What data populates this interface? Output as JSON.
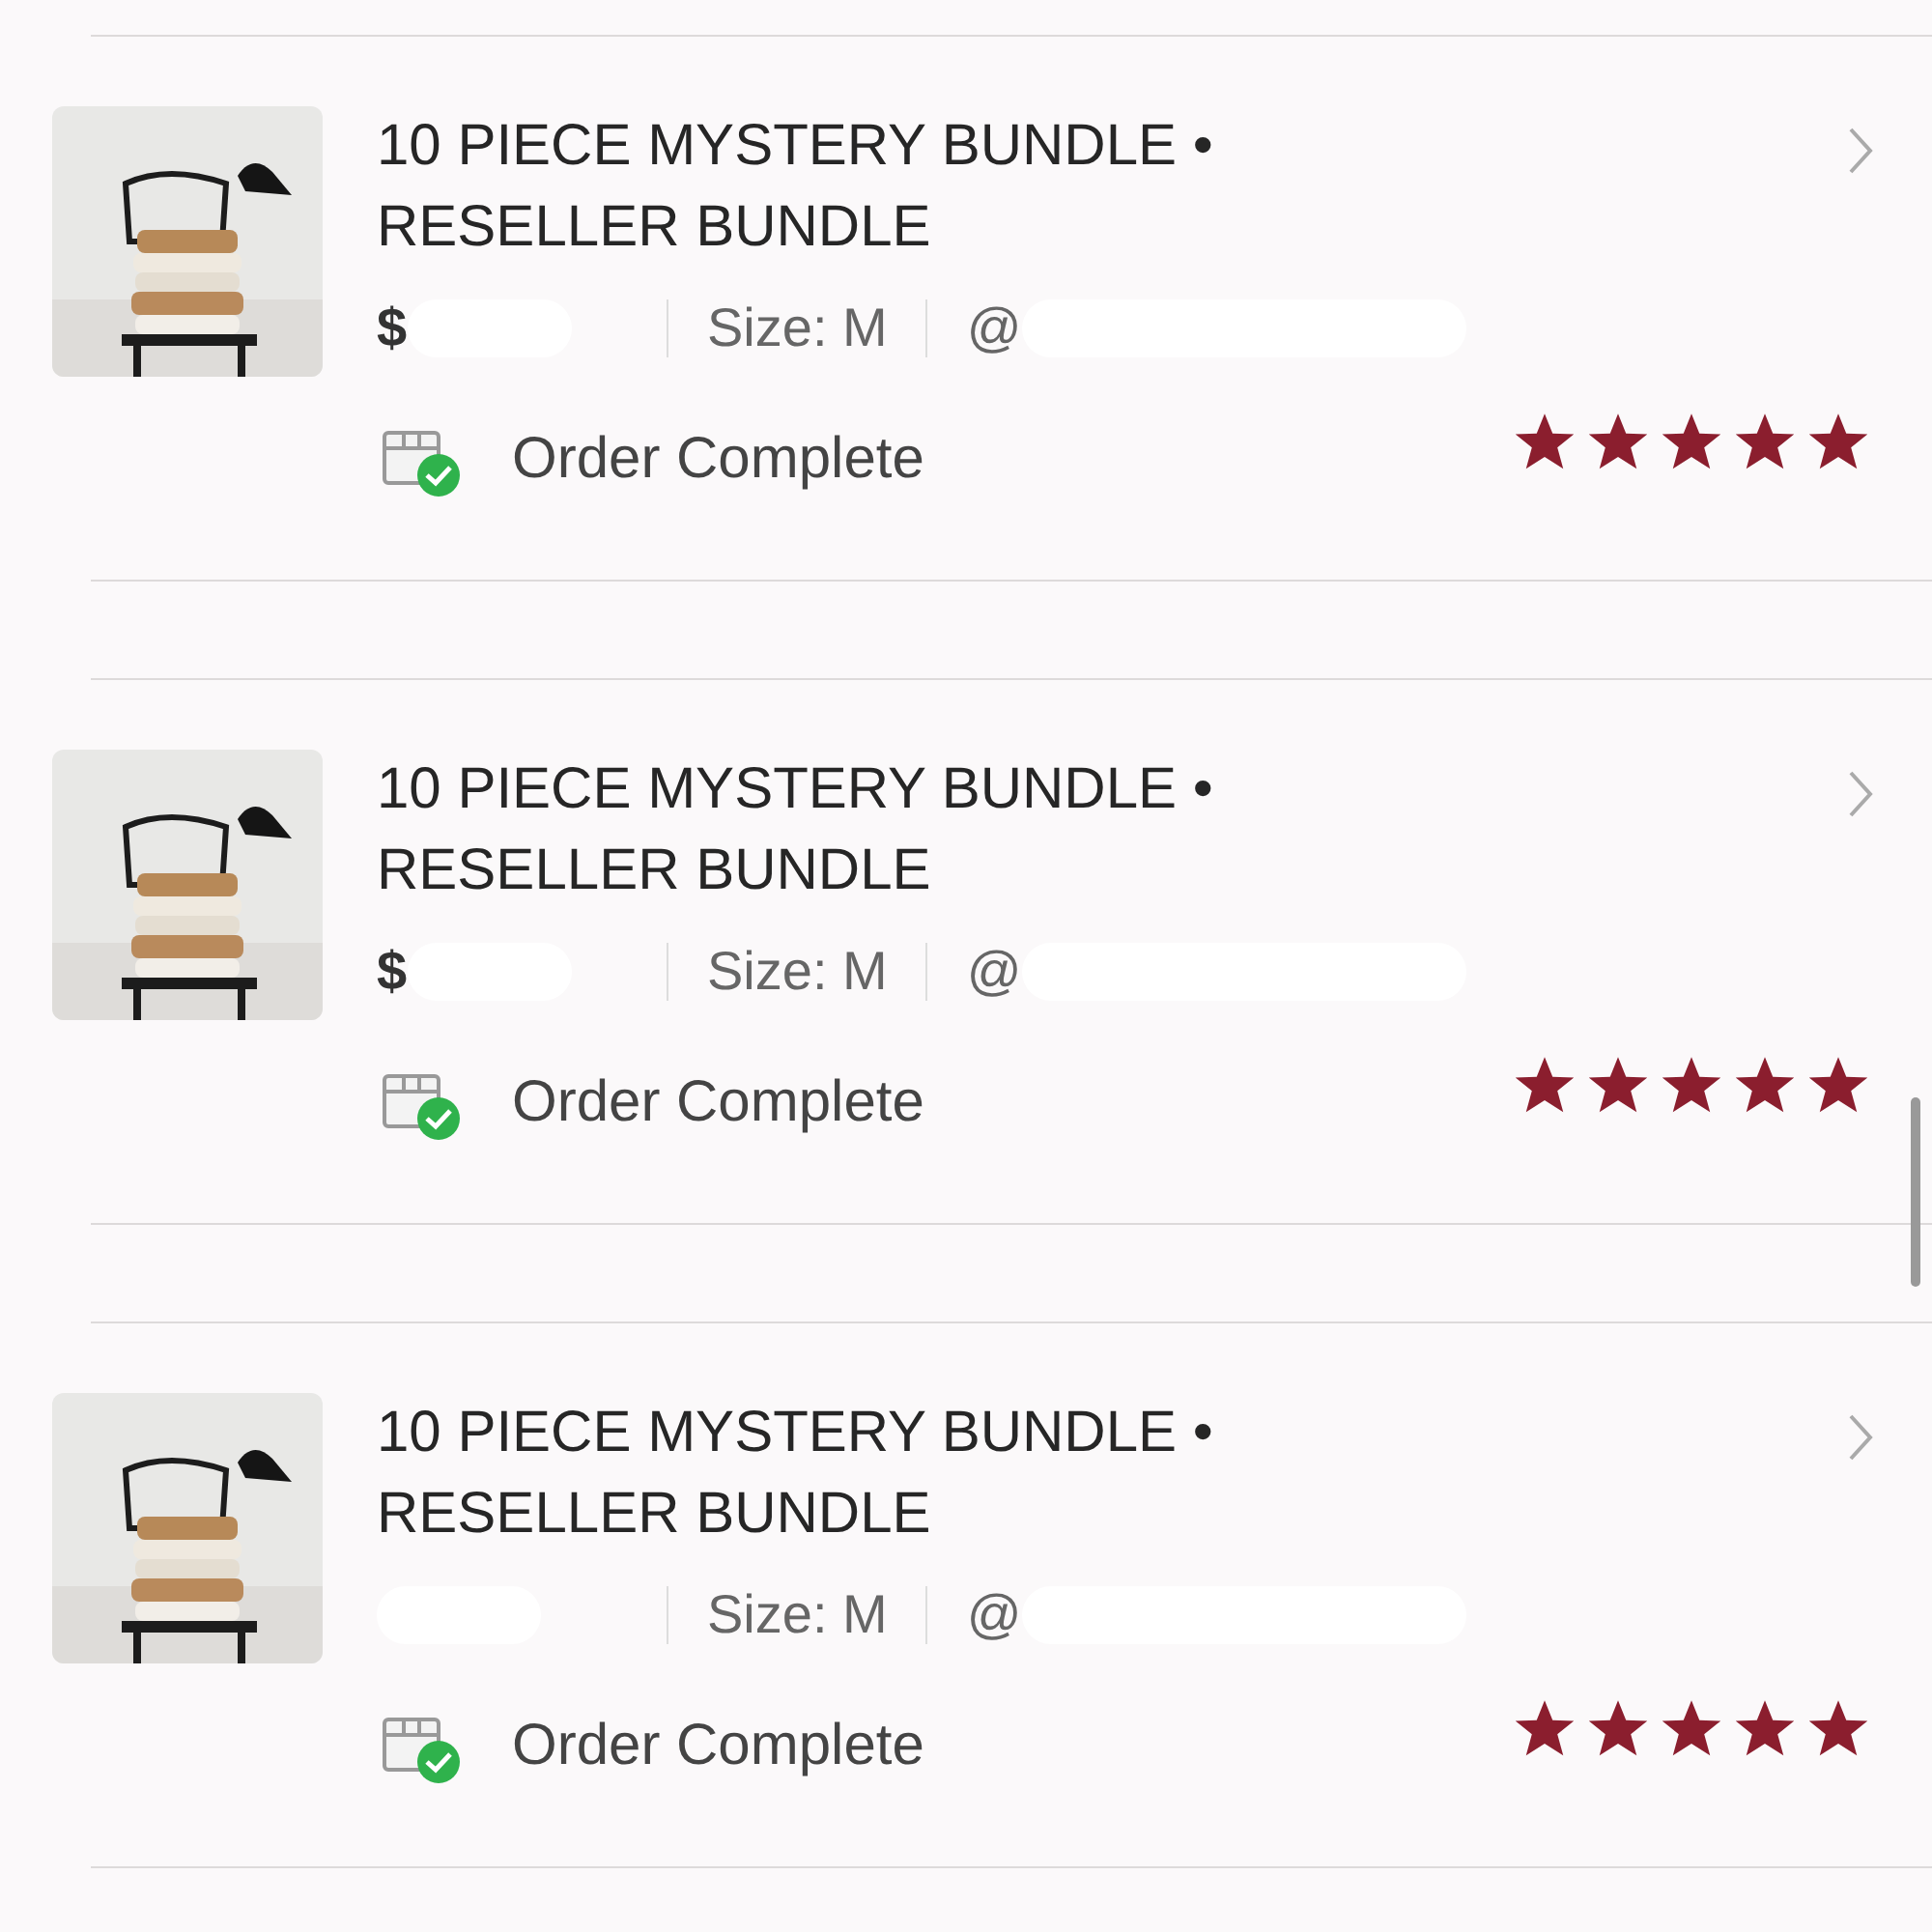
{
  "orders": [
    {
      "title": "10 PIECE MYSTERY BUNDLE • RESELLER BUNDLE",
      "price": "$",
      "size": "Size: M",
      "seller": "@",
      "status": "Order Complete",
      "stars": 5
    },
    {
      "title": "10 PIECE MYSTERY BUNDLE • RESELLER BUNDLE",
      "price": "$",
      "size": "Size: M",
      "seller": "@",
      "status": "Order Complete",
      "stars": 5
    },
    {
      "title": "10 PIECE MYSTERY BUNDLE • RESELLER BUNDLE",
      "size": "Size: M",
      "seller": "@",
      "status": "Order Complete",
      "stars": 5
    }
  ]
}
